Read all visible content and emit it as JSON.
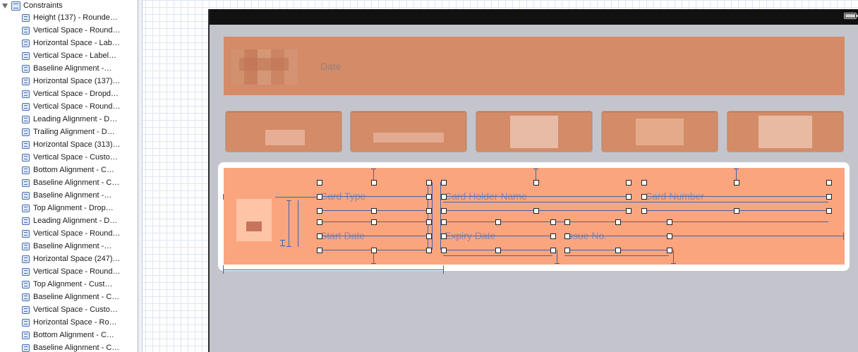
{
  "outline": {
    "header": "Constraints",
    "items": [
      "Height (137) - Rounde…",
      "Vertical Space - Round…",
      "Horizontal Space - Lab…",
      "Vertical Space - Label…",
      "Baseline Alignment -…",
      "Horizontal Space (137)…",
      "Vertical Space - Dropd…",
      "Vertical Space - Round…",
      "Leading Alignment - D…",
      "Trailing Alignment - D…",
      "Horizontal Space (313)…",
      "Vertical Space - Custo…",
      "Bottom Alignment - C…",
      "Baseline Alignment - C…",
      "Baseline Alignment -…",
      "Top Alignment - Drop…",
      "Leading Alignment - D…",
      "Vertical Space - Round…",
      "Baseline Alignment -…",
      "Horizontal Space (247)…",
      "Vertical Space - Round…",
      "Top Alignment - Cust…",
      "Baseline Alignment - C…",
      "Vertical Space - Custo…",
      "Horizontal Space - Ro…",
      "Bottom Alignment - C…",
      "Baseline Alignment - C…"
    ]
  },
  "view": {
    "date_label": "Date",
    "fields": {
      "card_type": "Card Type",
      "card_holder_name": "Card Holder Name",
      "card_number": "Card Number",
      "start_date": "Start Date",
      "expiry_date": "Expiry Date",
      "issue_no": "Issue No."
    }
  },
  "colors": {
    "header_panel": "#d48b68",
    "details_panel": "#fba57f",
    "device_background": "#c4c5cc",
    "constraint_line": "#3f62b0"
  }
}
